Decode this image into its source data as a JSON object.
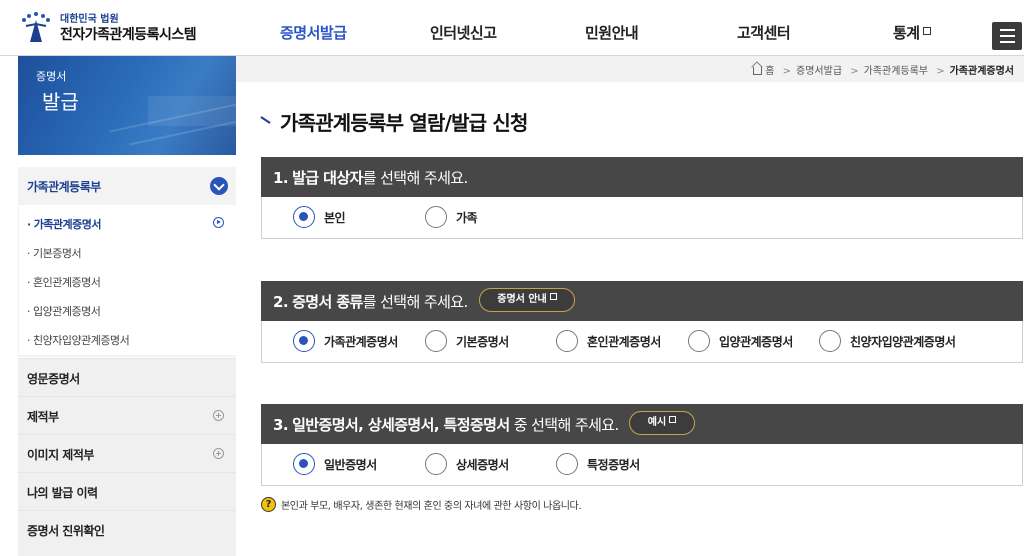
{
  "header": {
    "logo_sub": "대한민국 법원",
    "logo_main": "전자가족관계등록시스템",
    "nav": [
      {
        "label": "증명서발급",
        "active": true
      },
      {
        "label": "인터넷신고",
        "active": false
      },
      {
        "label": "민원안내",
        "active": false
      },
      {
        "label": "고객센터",
        "active": false
      },
      {
        "label": "통계",
        "active": false
      }
    ]
  },
  "sidebar": {
    "banner_small": "증명서",
    "banner_big": "발급",
    "groups": [
      {
        "label": "가족관계등록부",
        "expanded": true,
        "items": [
          "가족관계증명서",
          "기본증명서",
          "혼인관계증명서",
          "입양관계증명서",
          "친양자입양관계증명서"
        ]
      },
      {
        "label": "영문증명서"
      },
      {
        "label": "제적부"
      },
      {
        "label": "이미지 제적부"
      },
      {
        "label": "나의 발급 이력"
      },
      {
        "label": "증명서 진위확인"
      }
    ]
  },
  "breadcrumb": [
    "홈",
    "증명서발급",
    "가족관계등록부",
    "가족관계증명서"
  ],
  "page_title": "가족관계등록부 열람/발급 신청",
  "sections": [
    {
      "num": "1.",
      "bold": "발급 대상자",
      "rest": "를 선택해 주세요.",
      "options": [
        "본인",
        "가족"
      ],
      "selected": 0
    },
    {
      "num": "2.",
      "bold": "증명서 종류",
      "rest": "를 선택해 주세요.",
      "button": "증명서 안내",
      "options": [
        "가족관계증명서",
        "기본증명서",
        "혼인관계증명서",
        "입양관계증명서",
        "친양자입양관계증명서"
      ],
      "selected": 0
    },
    {
      "num": "3.",
      "bold": "일반증명서, 상세증명서, 특정증명서",
      "rest": " 중 선택해 주세요.",
      "button": "예시",
      "options": [
        "일반증명서",
        "상세증명서",
        "특정증명서"
      ],
      "selected": 0
    }
  ],
  "note": "본인과 부모, 배우자, 생존한 현재의 혼인 중의 자녀에 관한 사항이 나옵니다.",
  "colors": {
    "primary": "#2a55b8",
    "section_header": "#474747",
    "pill_border": "#c9a34a"
  }
}
